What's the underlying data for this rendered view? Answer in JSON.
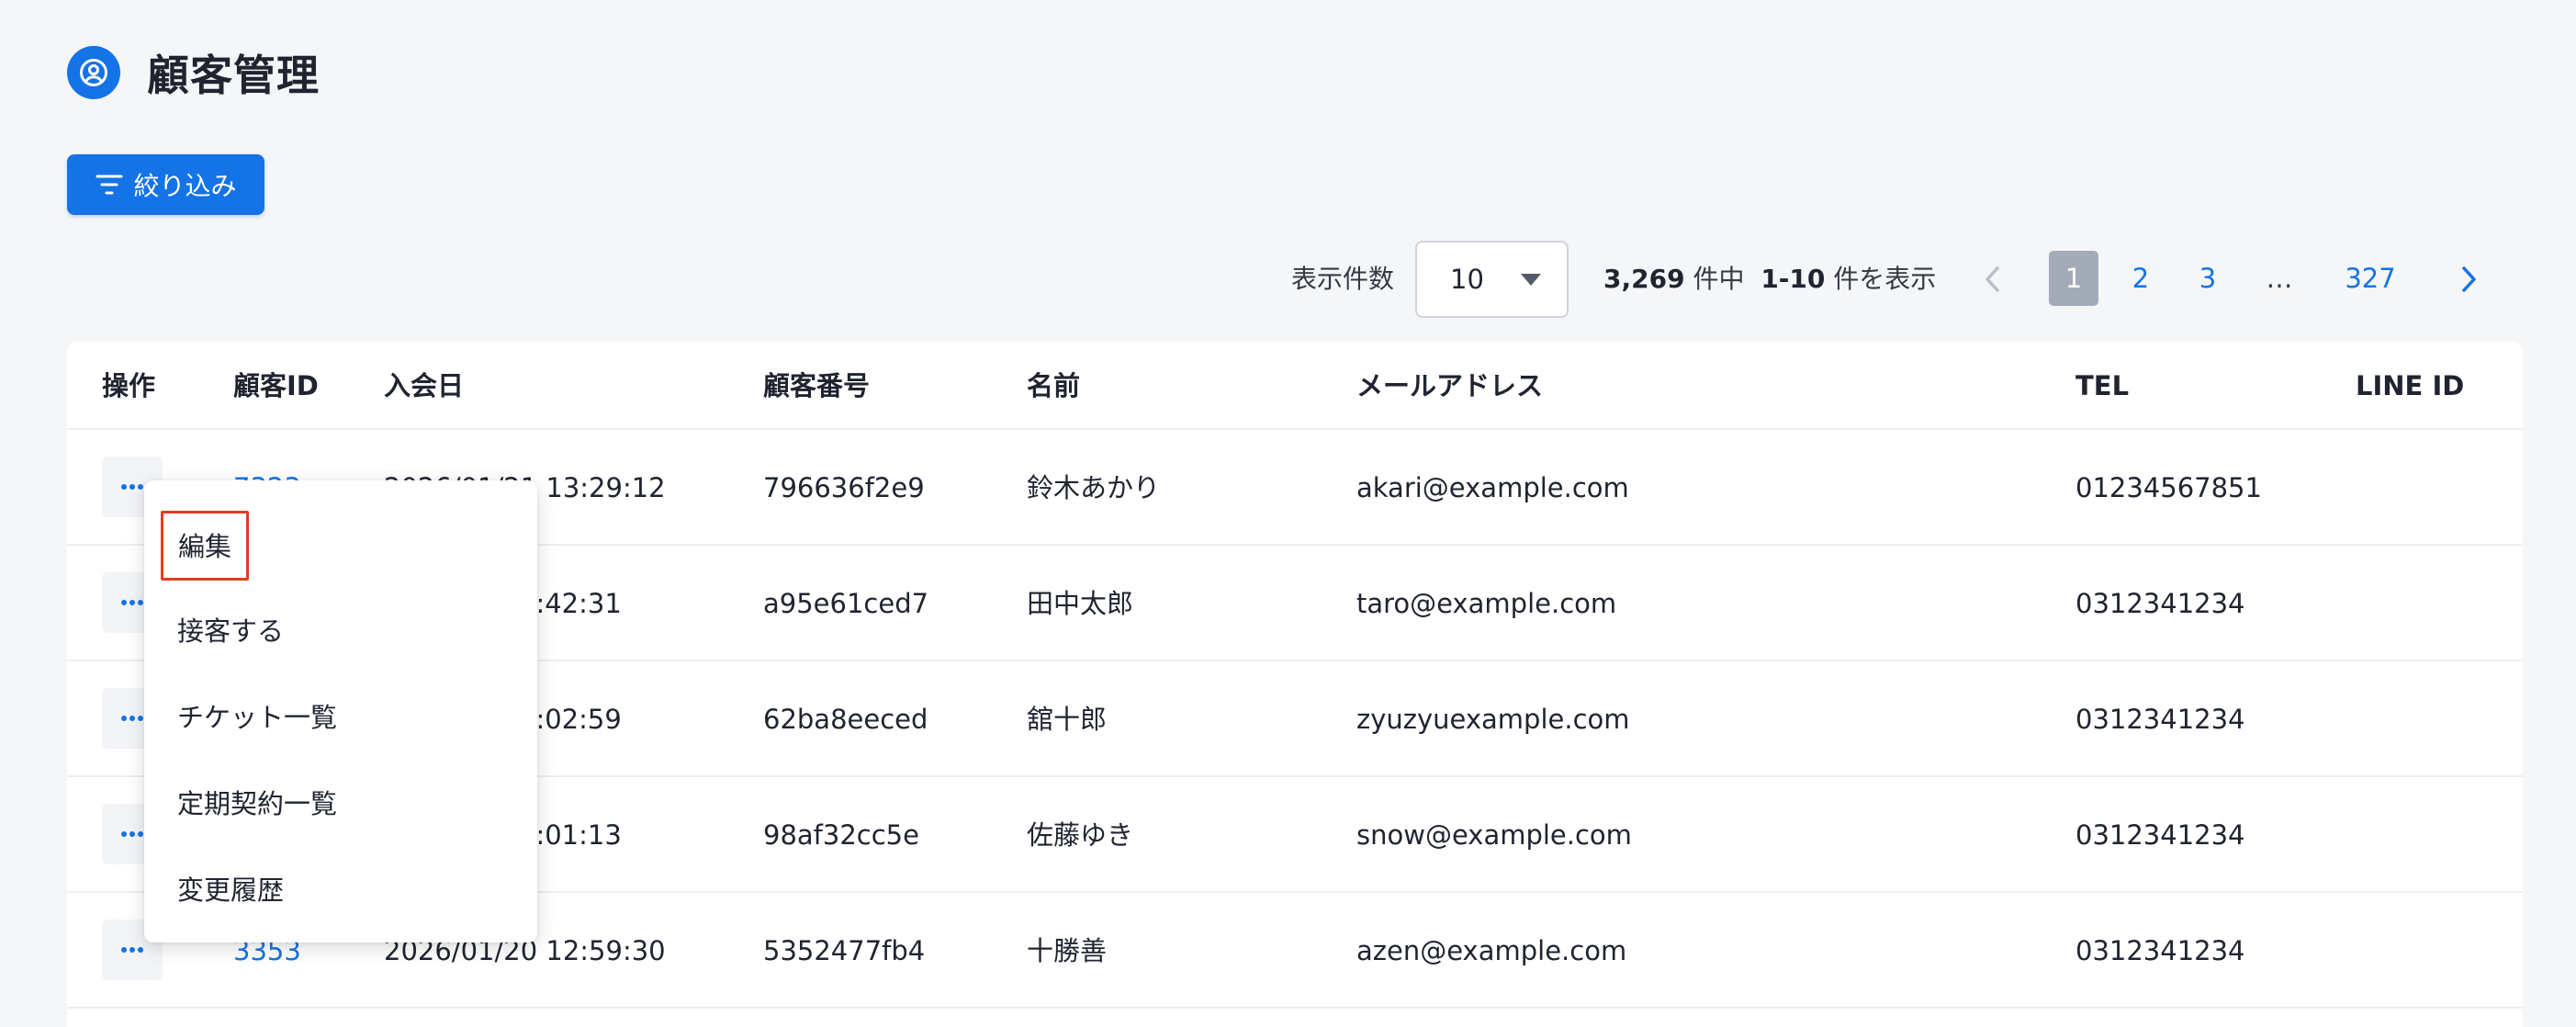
{
  "header": {
    "title": "顧客管理",
    "icon": "user-circle-icon"
  },
  "toolbar": {
    "filter_label": "絞り込み",
    "filter_icon": "filter-icon"
  },
  "pagination": {
    "per_page_label": "表示件数",
    "per_page_value": "10",
    "total": "3,269",
    "total_suffix": "件中",
    "range": "1-10",
    "range_suffix": "件を表示",
    "pages": [
      "1",
      "2",
      "3",
      "…",
      "327"
    ],
    "current_page": "1"
  },
  "table": {
    "columns": [
      "操作",
      "顧客ID",
      "入会日",
      "顧客番号",
      "名前",
      "メールアドレス",
      "TEL",
      "LINE ID"
    ],
    "rows": [
      {
        "id": "7323",
        "joined": "2026/01/21 13:29:12",
        "number": "796636f2e9",
        "name": "鈴木あかり",
        "email": "akari@example.com",
        "tel": "01234567851",
        "line_id": ""
      },
      {
        "id": "",
        "joined": "5:42:31",
        "number": "a95e61ced7",
        "name": "田中太郎",
        "email": "taro@example.com",
        "tel": "0312341234",
        "line_id": ""
      },
      {
        "id": "",
        "joined": "3:02:59",
        "number": "62ba8eeced",
        "name": "舘十郎",
        "email": "zyuzyuexample.com",
        "tel": "0312341234",
        "line_id": ""
      },
      {
        "id": "",
        "joined": "3:01:13",
        "number": "98af32cc5e",
        "name": "佐藤ゆき",
        "email": "snow@example.com",
        "tel": "0312341234",
        "line_id": ""
      },
      {
        "id": "3353",
        "joined": "2026/01/20 12:59:30",
        "number": "5352477fb4",
        "name": "十勝善",
        "email": "azen@example.com",
        "tel": "0312341234",
        "line_id": ""
      }
    ]
  },
  "context_menu": {
    "items": [
      "編集",
      "接客する",
      "チケット一覧",
      "定期契約一覧",
      "変更履歴"
    ],
    "highlighted": "編集"
  },
  "colors": {
    "accent": "#1473e6",
    "highlight_border": "#e23d1f",
    "active_page": "#a3abb8"
  }
}
